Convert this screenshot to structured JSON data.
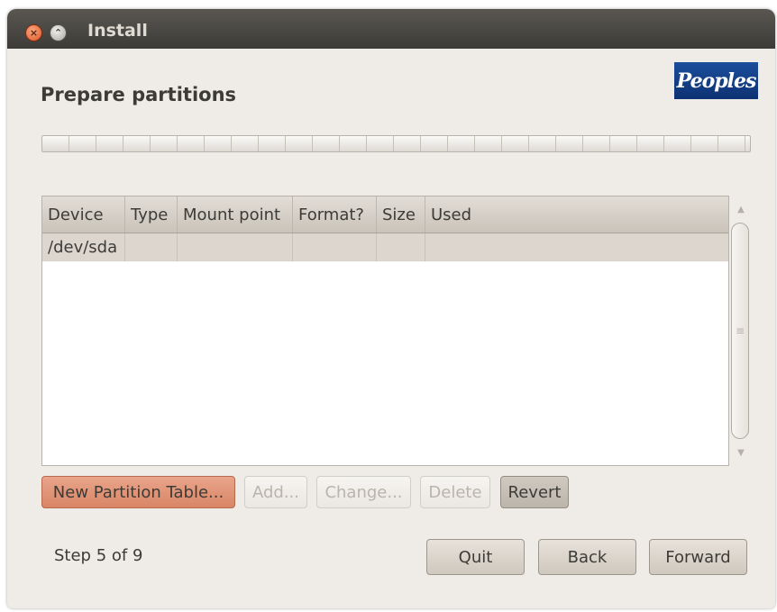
{
  "window": {
    "title": "Install"
  },
  "logo": {
    "text": "Peoples"
  },
  "page": {
    "title": "Prepare partitions"
  },
  "progress": {
    "fraction": 0
  },
  "table": {
    "columns": [
      "Device",
      "Type",
      "Mount point",
      "Format?",
      "Size",
      "Used"
    ],
    "rows": [
      [
        "/dev/sda",
        "",
        "",
        "",
        "",
        ""
      ]
    ]
  },
  "actions": {
    "new_partition_table": "New Partition Table...",
    "add": "Add...",
    "change": "Change...",
    "delete": "Delete",
    "revert": "Revert"
  },
  "footer": {
    "step": "Step 5 of 9",
    "quit": "Quit",
    "back": "Back",
    "forward": "Forward"
  },
  "icons": {
    "close": "close-icon",
    "minimize": "minimize-icon"
  },
  "colors": {
    "accent": "#dd4814",
    "background": "#efebe6",
    "titlebar": "#3c3b37"
  }
}
